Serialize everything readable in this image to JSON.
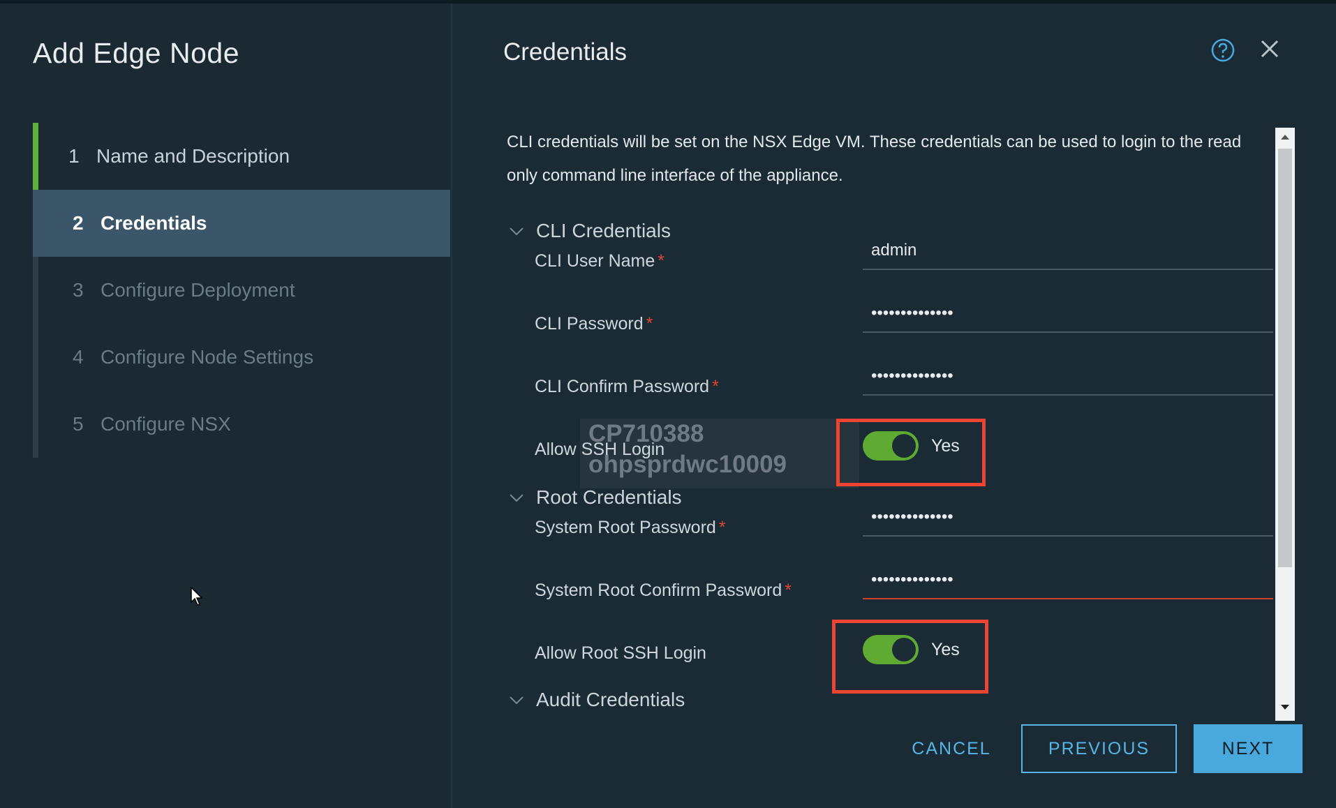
{
  "wizard": {
    "title": "Add Edge Node",
    "steps": [
      {
        "num": "1",
        "label": "Name and Description",
        "state": "done"
      },
      {
        "num": "2",
        "label": "Credentials",
        "state": "active"
      },
      {
        "num": "3",
        "label": "Configure Deployment",
        "state": "todo"
      },
      {
        "num": "4",
        "label": "Configure Node Settings",
        "state": "todo"
      },
      {
        "num": "5",
        "label": "Configure NSX",
        "state": "todo"
      }
    ]
  },
  "page": {
    "title": "Credentials",
    "description": "CLI credentials will be set on the NSX Edge VM. These credentials can be used to login to the read only command line interface of the appliance."
  },
  "cli": {
    "section_label": "CLI Credentials",
    "user_name_label": "CLI User Name",
    "user_name_value": "admin",
    "password_label": "CLI Password",
    "password_value": "••••••••••••••",
    "confirm_label": "CLI Confirm Password",
    "confirm_value": "••••••••••••••",
    "ssh_label": "Allow SSH Login",
    "ssh_value": "Yes"
  },
  "root": {
    "section_label": "Root Credentials",
    "password_label": "System Root Password",
    "password_value": "••••••••••••••",
    "confirm_label": "System Root Confirm Password",
    "confirm_value": "••••••••••••••",
    "ssh_label": "Allow Root SSH Login",
    "ssh_value": "Yes"
  },
  "audit": {
    "section_label": "Audit Credentials"
  },
  "watermark": {
    "line1": "CP710388",
    "line2": "ohpsprdwc10009"
  },
  "required_mark": "*",
  "buttons": {
    "cancel": "CANCEL",
    "previous": "PREVIOUS",
    "next": "NEXT"
  },
  "colors": {
    "accent": "#49a9dd",
    "toggle_on": "#5faa32",
    "highlight": "#ee4434",
    "step_done": "#61b23c"
  },
  "icons": {
    "help": "help-circle-icon",
    "close": "close-icon",
    "section": "chevron-down-icon"
  }
}
